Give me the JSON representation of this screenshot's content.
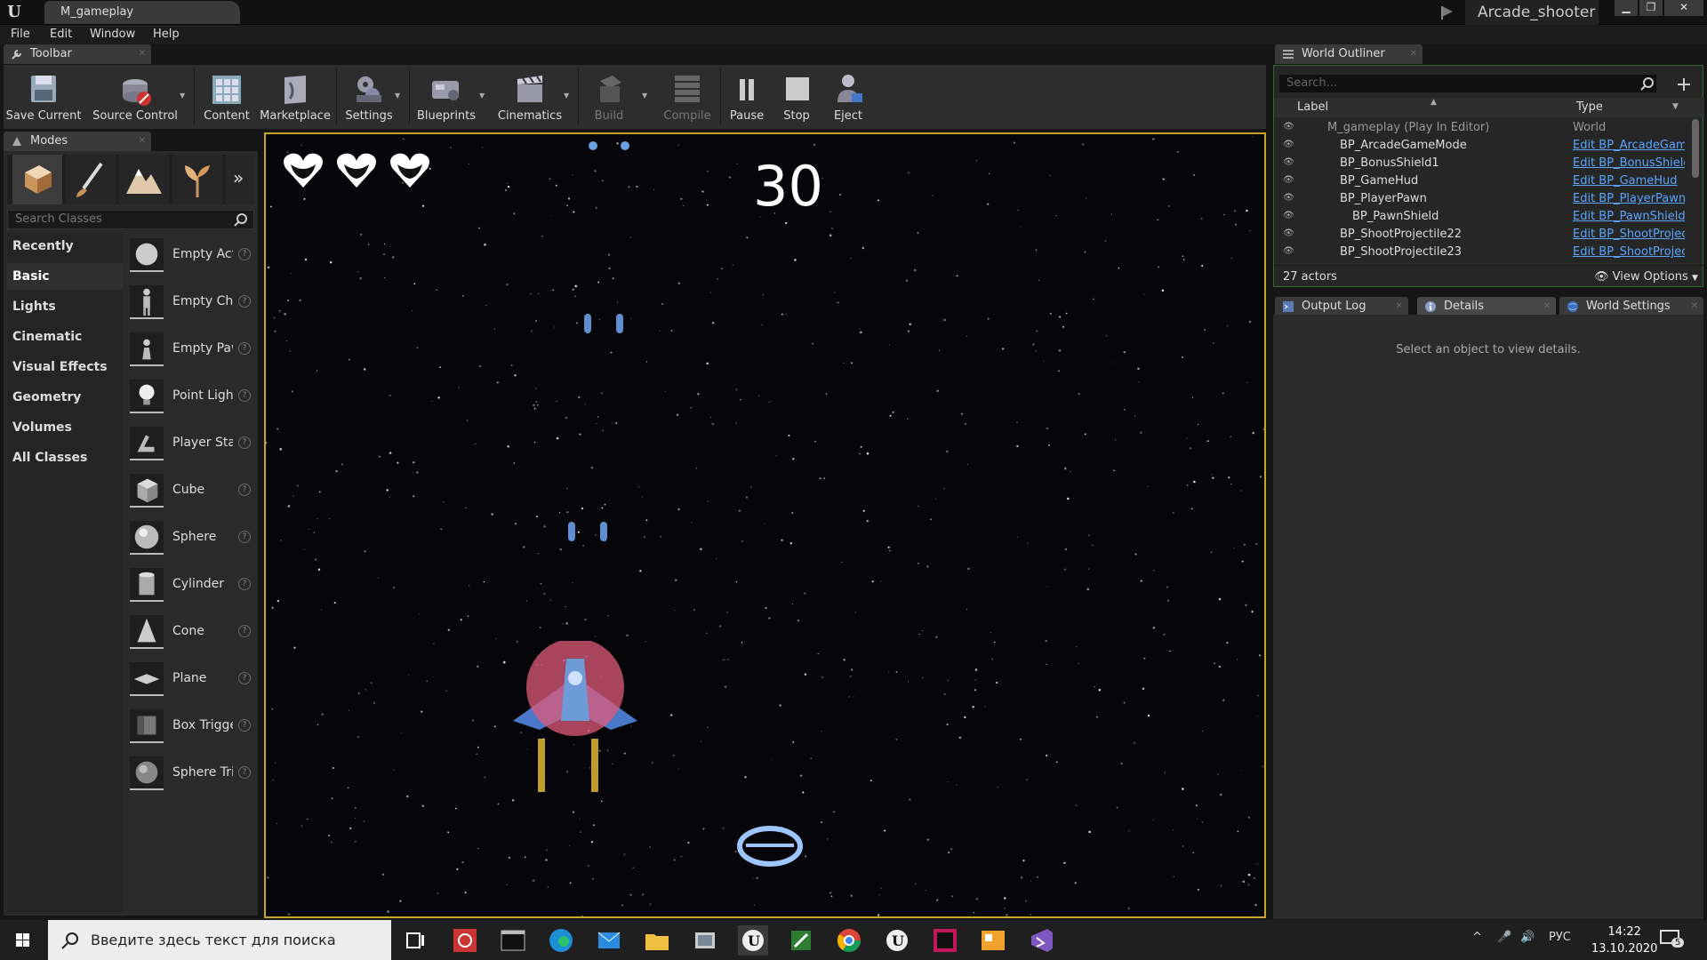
{
  "titlebar": {
    "document_tab": "M_gameplay",
    "project_name": "Arcade_shooter",
    "window_buttons": {
      "minimize": "▁",
      "restore": "❐",
      "close": "✕"
    }
  },
  "menu": [
    "File",
    "Edit",
    "Window",
    "Help"
  ],
  "toolbar": {
    "tab_label": "Toolbar",
    "items": [
      {
        "label": "Save Current",
        "icon": "save-icon"
      },
      {
        "label": "Source Control",
        "icon": "source-control-icon"
      },
      {
        "label": "Content",
        "icon": "content-icon"
      },
      {
        "label": "Marketplace",
        "icon": "marketplace-icon"
      },
      {
        "label": "Settings",
        "icon": "settings-icon"
      },
      {
        "label": "Blueprints",
        "icon": "blueprints-icon"
      },
      {
        "label": "Cinematics",
        "icon": "cinematics-icon"
      },
      {
        "label": "Build",
        "icon": "build-icon",
        "disabled": true
      },
      {
        "label": "Compile",
        "icon": "compile-icon",
        "disabled": true
      },
      {
        "label": "Pause",
        "icon": "pause-icon"
      },
      {
        "label": "Stop",
        "icon": "stop-icon"
      },
      {
        "label": "Eject",
        "icon": "eject-icon"
      }
    ]
  },
  "modes": {
    "tab_label": "Modes",
    "search_placeholder": "Search Classes",
    "categories": [
      "Recently Placed",
      "Basic",
      "Lights",
      "Cinematic",
      "Visual Effects",
      "Geometry",
      "Volumes",
      "All Classes"
    ],
    "selected_category": "Basic",
    "classes": [
      "Empty Actor",
      "Empty Character",
      "Empty Pawn",
      "Point Light",
      "Player Start",
      "Cube",
      "Sphere",
      "Cylinder",
      "Cone",
      "Plane",
      "Box Trigger",
      "Sphere Trigger"
    ],
    "help_glyph": "?"
  },
  "viewport": {
    "score": "30",
    "lives": 3
  },
  "outliner": {
    "tab_label": "World Outliner",
    "search_placeholder": "Search...",
    "col_label": "Label",
    "col_type": "Type",
    "rows": [
      {
        "label": "M_gameplay (Play In Editor)",
        "type": "World",
        "indent": 0,
        "type_link": false
      },
      {
        "label": "BP_ArcadeGameMode",
        "type": "Edit BP_ArcadeGameMode",
        "indent": 1,
        "type_link": true
      },
      {
        "label": "BP_BonusShield1",
        "type": "Edit BP_BonusShield",
        "indent": 1,
        "type_link": true
      },
      {
        "label": "BP_GameHud",
        "type": "Edit BP_GameHud",
        "indent": 1,
        "type_link": true
      },
      {
        "label": "BP_PlayerPawn",
        "type": "Edit BP_PlayerPawn",
        "indent": 1,
        "type_link": true
      },
      {
        "label": "BP_PawnShield",
        "type": "Edit BP_PawnShield",
        "indent": 2,
        "type_link": true
      },
      {
        "label": "BP_ShootProjectile22",
        "type": "Edit BP_ShootProjectile",
        "indent": 1,
        "type_link": true
      },
      {
        "label": "BP_ShootProjectile23",
        "type": "Edit BP_ShootProjectile",
        "indent": 1,
        "type_link": true
      }
    ],
    "actor_count": "27 actors",
    "view_options": "View Options"
  },
  "details": {
    "tabs": [
      "Output Log",
      "Details",
      "World Settings"
    ],
    "empty_message": "Select an object to view details."
  },
  "taskbar": {
    "search_placeholder": "Введите здесь текст для поиска",
    "language": "РУС",
    "time": "14:22",
    "date": "13.10.2020",
    "notifications": "5"
  },
  "colors": {
    "viewport_border": "#c9a227",
    "outliner_border": "#2e6b2e",
    "link": "#5aa5ff",
    "shield": "#e05a7a"
  }
}
